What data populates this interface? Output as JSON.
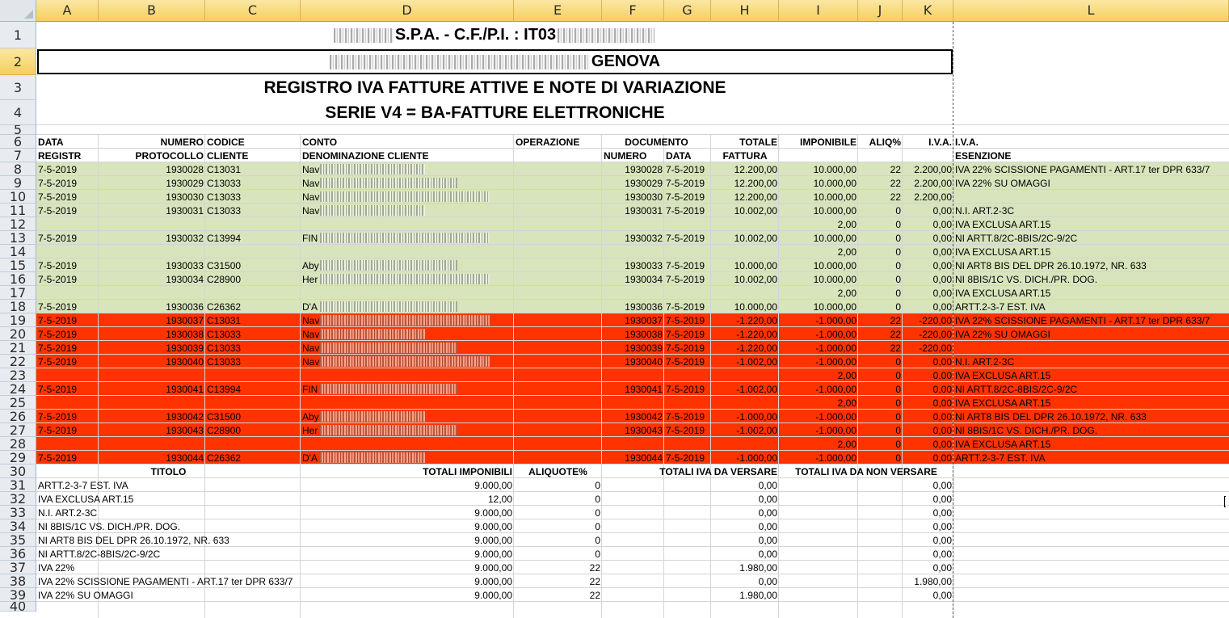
{
  "columns": [
    "A",
    "B",
    "C",
    "D",
    "E",
    "F",
    "G",
    "H",
    "I",
    "J",
    "K",
    "L"
  ],
  "rows": [
    "1",
    "2",
    "3",
    "4",
    "5",
    "6",
    "7",
    "8",
    "9",
    "10",
    "11",
    "12",
    "13",
    "14",
    "15",
    "16",
    "17",
    "18",
    "19",
    "20",
    "21",
    "22",
    "23",
    "24",
    "25",
    "26",
    "27",
    "28",
    "29",
    "30",
    "31",
    "32",
    "33",
    "34",
    "35",
    "36",
    "37",
    "38",
    "39",
    "40"
  ],
  "header": {
    "line1": "S.P.A. - C.F./P.I. : IT03",
    "line2": "GENOVA",
    "title": "REGISTRO IVA FATTURE ATTIVE E NOTE DI VARIAZIONE",
    "subtitle": "SERIE V4 = BA-FATTURE ELETTRONICHE"
  },
  "table_headers": {
    "row6": [
      "DATA",
      "NUMERO",
      "CODICE",
      "CONTO",
      "OPERAZIONE",
      "DOCUMENTO",
      "TOTALE",
      "IMPONIBILE",
      "ALIQ%",
      "I.V.A.",
      "I.V.A."
    ],
    "row7": [
      "REGISTR",
      "PROTOCOLLO",
      "CLIENTE",
      "DENOMINAZIONE CLIENTE",
      "NUMERO",
      "DATA",
      "FATTURA",
      "ESENZIONE"
    ]
  },
  "entries": [
    {
      "data": "7-5-2019",
      "protocollo": "1930028",
      "cliente": "C13031",
      "denominazione": "Nav",
      "numero": "1930028",
      "data_doc": "7-5-2019",
      "totale": "12.200,00",
      "imponibile": "10.000,00",
      "aliq": "22",
      "iva": "2.200,00",
      "esenzione": "IVA 22% SCISSIONE PAGAMENTI - ART.17 ter DPR 633/7"
    },
    {
      "data": "7-5-2019",
      "protocollo": "1930029",
      "cliente": "C13033",
      "denominazione": "Nav",
      "numero": "1930029",
      "data_doc": "7-5-2019",
      "totale": "12.200,00",
      "imponibile": "10.000,00",
      "aliq": "22",
      "iva": "2.200,00",
      "esenzione": "IVA 22% SU OMAGGI"
    },
    {
      "data": "7-5-2019",
      "protocollo": "1930030",
      "cliente": "C13033",
      "denominazione": "Nav",
      "numero": "1930030",
      "data_doc": "7-5-2019",
      "totale": "12.200,00",
      "imponibile": "10.000,00",
      "aliq": "22",
      "iva": "2.200,00",
      "esenzione": ""
    },
    {
      "data": "7-5-2019",
      "protocollo": "1930031",
      "cliente": "C13033",
      "denominazione": "Nav",
      "numero": "1930031",
      "data_doc": "7-5-2019",
      "totale": "10.002,00",
      "imponibile": "10.000,00",
      "aliq": "0",
      "iva": "0,00",
      "esenzione": "N.I. ART.2-3C"
    },
    {
      "data": "",
      "protocollo": "",
      "cliente": "",
      "denominazione": "",
      "numero": "",
      "data_doc": "",
      "totale": "",
      "imponibile": "2,00",
      "aliq": "0",
      "iva": "0,00",
      "esenzione": "IVA EXCLUSA ART.15"
    },
    {
      "data": "7-5-2019",
      "protocollo": "1930032",
      "cliente": "C13994",
      "denominazione": "FIN",
      "numero": "1930032",
      "data_doc": "7-5-2019",
      "totale": "10.002,00",
      "imponibile": "10.000,00",
      "aliq": "0",
      "iva": "0,00",
      "esenzione": "NI ARTT.8/2C-8BIS/2C-9/2C"
    },
    {
      "data": "",
      "protocollo": "",
      "cliente": "",
      "denominazione": "",
      "numero": "",
      "data_doc": "",
      "totale": "",
      "imponibile": "2,00",
      "aliq": "0",
      "iva": "0,00",
      "esenzione": "IVA EXCLUSA ART.15"
    },
    {
      "data": "7-5-2019",
      "protocollo": "1930033",
      "cliente": "C31500",
      "denominazione": "Aby",
      "numero": "1930033",
      "data_doc": "7-5-2019",
      "totale": "10.000,00",
      "imponibile": "10.000,00",
      "aliq": "0",
      "iva": "0,00",
      "esenzione": "NI ART8 BIS DEL DPR 26.10.1972, NR. 633"
    },
    {
      "data": "7-5-2019",
      "protocollo": "1930034",
      "cliente": "C28900",
      "denominazione": "Her",
      "numero": "1930034",
      "data_doc": "7-5-2019",
      "totale": "10.002,00",
      "imponibile": "10.000,00",
      "aliq": "0",
      "iva": "0,00",
      "esenzione": "NI 8BIS/1C VS. DICH./PR. DOG."
    },
    {
      "data": "",
      "protocollo": "",
      "cliente": "",
      "denominazione": "",
      "numero": "",
      "data_doc": "",
      "totale": "",
      "imponibile": "2,00",
      "aliq": "0",
      "iva": "0,00",
      "esenzione": "IVA EXCLUSA ART.15"
    },
    {
      "data": "7-5-2019",
      "protocollo": "1930036",
      "cliente": "C26362",
      "denominazione": "D'A",
      "numero": "1930036",
      "data_doc": "7-5-2019",
      "totale": "10.000,00",
      "imponibile": "10.000,00",
      "aliq": "0",
      "iva": "0,00",
      "esenzione": "ARTT.2-3-7 EST. IVA"
    },
    {
      "data": "7-5-2019",
      "protocollo": "1930037",
      "cliente": "C13031",
      "denominazione": "Nav",
      "numero": "1930037",
      "data_doc": "7-5-2019",
      "totale": "-1.220,00",
      "imponibile": "-1.000,00",
      "aliq": "22",
      "iva": "-220,00",
      "esenzione": "IVA 22% SCISSIONE PAGAMENTI - ART.17 ter DPR 633/7"
    },
    {
      "data": "7-5-2019",
      "protocollo": "1930038",
      "cliente": "C13033",
      "denominazione": "Nav",
      "numero": "1930038",
      "data_doc": "7-5-2019",
      "totale": "-1.220,00",
      "imponibile": "-1.000,00",
      "aliq": "22",
      "iva": "-220,00",
      "esenzione": "IVA 22% SU OMAGGI"
    },
    {
      "data": "7-5-2019",
      "protocollo": "1930039",
      "cliente": "C13033",
      "denominazione": "Nav",
      "numero": "1930039",
      "data_doc": "7-5-2019",
      "totale": "-1.220,00",
      "imponibile": "-1.000,00",
      "aliq": "22",
      "iva": "-220,00",
      "esenzione": ""
    },
    {
      "data": "7-5-2019",
      "protocollo": "1930040",
      "cliente": "C13033",
      "denominazione": "Nav",
      "numero": "1930040",
      "data_doc": "7-5-2019",
      "totale": "-1.002,00",
      "imponibile": "-1.000,00",
      "aliq": "0",
      "iva": "0,00",
      "esenzione": "N.I. ART.2-3C"
    },
    {
      "data": "",
      "protocollo": "",
      "cliente": "",
      "denominazione": "",
      "numero": "",
      "data_doc": "",
      "totale": "",
      "imponibile": "2,00",
      "aliq": "0",
      "iva": "0,00",
      "esenzione": "IVA EXCLUSA ART.15"
    },
    {
      "data": "7-5-2019",
      "protocollo": "1930041",
      "cliente": "C13994",
      "denominazione": "FIN",
      "numero": "1930041",
      "data_doc": "7-5-2019",
      "totale": "-1.002,00",
      "imponibile": "-1.000,00",
      "aliq": "0",
      "iva": "0,00",
      "esenzione": "NI ARTT.8/2C-8BIS/2C-9/2C"
    },
    {
      "data": "",
      "protocollo": "",
      "cliente": "",
      "denominazione": "",
      "numero": "",
      "data_doc": "",
      "totale": "",
      "imponibile": "2,00",
      "aliq": "0",
      "iva": "0,00",
      "esenzione": "IVA EXCLUSA ART.15"
    },
    {
      "data": "7-5-2019",
      "protocollo": "1930042",
      "cliente": "C31500",
      "denominazione": "Aby",
      "numero": "1930042",
      "data_doc": "7-5-2019",
      "totale": "-1.000,00",
      "imponibile": "-1.000,00",
      "aliq": "0",
      "iva": "0,00",
      "esenzione": "NI ART8 BIS DEL DPR 26.10.1972, NR. 633"
    },
    {
      "data": "7-5-2019",
      "protocollo": "1930043",
      "cliente": "C28900",
      "denominazione": "Her",
      "numero": "1930043",
      "data_doc": "7-5-2019",
      "totale": "-1.002,00",
      "imponibile": "-1.000,00",
      "aliq": "0",
      "iva": "0,00",
      "esenzione": "NI 8BIS/1C VS. DICH./PR. DOG."
    },
    {
      "data": "",
      "protocollo": "",
      "cliente": "",
      "denominazione": "",
      "numero": "",
      "data_doc": "",
      "totale": "",
      "imponibile": "2,00",
      "aliq": "0",
      "iva": "0,00",
      "esenzione": "IVA EXCLUSA ART.15"
    },
    {
      "data": "7-5-2019",
      "protocollo": "1930044",
      "cliente": "C26362",
      "denominazione": "D'A",
      "numero": "1930044",
      "data_doc": "7-5-2019",
      "totale": "-1.000,00",
      "imponibile": "-1.000,00",
      "aliq": "0",
      "iva": "0,00",
      "esenzione": "ARTT.2-3-7 EST. IVA"
    }
  ],
  "summary_headers": [
    "TITOLO",
    "TOTALI IMPONIBILI",
    "ALIQUOTE%",
    "TOTALI IVA DA VERSARE",
    "TOTALI IVA DA NON VERSARE"
  ],
  "summary": [
    {
      "titolo": "ARTT.2-3-7 EST. IVA",
      "imponibili": "9.000,00",
      "aliquote": "0",
      "versare": "0,00",
      "non_versare": "0,00"
    },
    {
      "titolo": "IVA EXCLUSA ART.15",
      "imponibili": "12,00",
      "aliquote": "0",
      "versare": "0,00",
      "non_versare": "0,00"
    },
    {
      "titolo": "N.I. ART.2-3C",
      "imponibili": "9.000,00",
      "aliquote": "0",
      "versare": "0,00",
      "non_versare": "0,00"
    },
    {
      "titolo": "NI 8BIS/1C VS. DICH./PR. DOG.",
      "imponibili": "9.000,00",
      "aliquote": "0",
      "versare": "0,00",
      "non_versare": "0,00"
    },
    {
      "titolo": "NI ART8 BIS DEL DPR 26.10.1972, NR. 633",
      "imponibili": "9.000,00",
      "aliquote": "0",
      "versare": "0,00",
      "non_versare": "0,00"
    },
    {
      "titolo": "NI ARTT.8/2C-8BIS/2C-9/2C",
      "imponibili": "9.000,00",
      "aliquote": "0",
      "versare": "0,00",
      "non_versare": "0,00"
    },
    {
      "titolo": "IVA 22%",
      "imponibili": "9.000,00",
      "aliquote": "22",
      "versare": "1.980,00",
      "non_versare": "0,00"
    },
    {
      "titolo": "IVA 22% SCISSIONE PAGAMENTI - ART.17 ter DPR 633/7",
      "imponibili": "9.000,00",
      "aliquote": "22",
      "versare": "0,00",
      "non_versare": "1.980,00"
    },
    {
      "titolo": "IVA 22% SU OMAGGI",
      "imponibili": "9.000,00",
      "aliquote": "22",
      "versare": "1.980,00",
      "non_versare": "0,00"
    }
  ],
  "colors": {
    "invoice_fill": "#d8e4bc",
    "credit_note_fill": "#ff3300",
    "column_header": "#f6cf5d",
    "row_header": "#e8ebf0",
    "gridline": "#d4d4d4"
  }
}
